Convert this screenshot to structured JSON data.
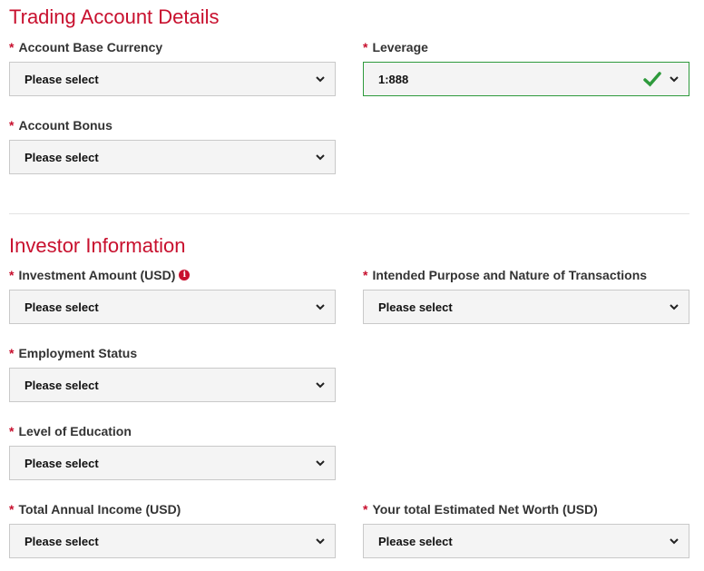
{
  "trading": {
    "title": "Trading Account Details",
    "currency": {
      "label": "Account Base Currency",
      "value": "Please select"
    },
    "leverage": {
      "label": "Leverage",
      "value": "1:888"
    },
    "bonus": {
      "label": "Account Bonus",
      "value": "Please select"
    }
  },
  "investor": {
    "title": "Investor Information",
    "investment": {
      "label": "Investment Amount (USD)",
      "value": "Please select"
    },
    "purpose": {
      "label": "Intended Purpose and Nature of Transactions",
      "value": "Please select"
    },
    "employment": {
      "label": "Employment Status",
      "value": "Please select"
    },
    "education": {
      "label": "Level of Education",
      "value": "Please select"
    },
    "income": {
      "label": "Total Annual Income (USD)",
      "value": "Please select"
    },
    "networth": {
      "label": "Your total Estimated Net Worth (USD)",
      "value": "Please select"
    }
  },
  "required_marker": "*",
  "info_glyph": "i",
  "colors": {
    "accent": "#c8102e",
    "valid": "#2e9a3c",
    "field_bg": "#f4f4f4",
    "field_border": "#c9c9c9"
  }
}
